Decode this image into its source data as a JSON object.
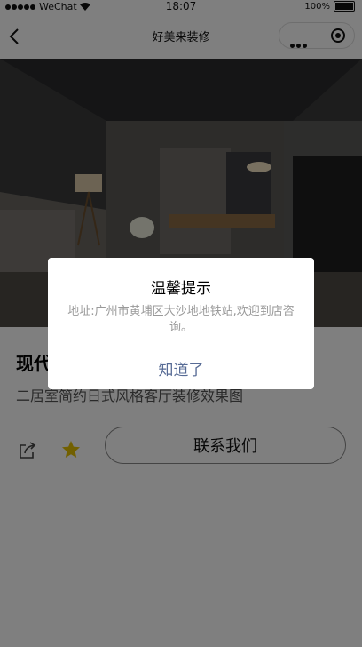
{
  "status_bar": {
    "carrier": "WeChat",
    "time": "18:07",
    "battery": "100%"
  },
  "nav": {
    "title": "好美来装修"
  },
  "product": {
    "title": "现代",
    "description": "二居室简约日式风格客厅装修效果图"
  },
  "actions": {
    "contact_label": "联系我们"
  },
  "modal": {
    "title": "温馨提示",
    "content": "地址:广州市黄埔区大沙地地铁站,欢迎到店咨询。",
    "confirm_label": "知道了"
  },
  "colors": {
    "star": "#e5c100",
    "confirm_text": "#576b95",
    "mask": "rgba(0,0,0,0.5)"
  }
}
